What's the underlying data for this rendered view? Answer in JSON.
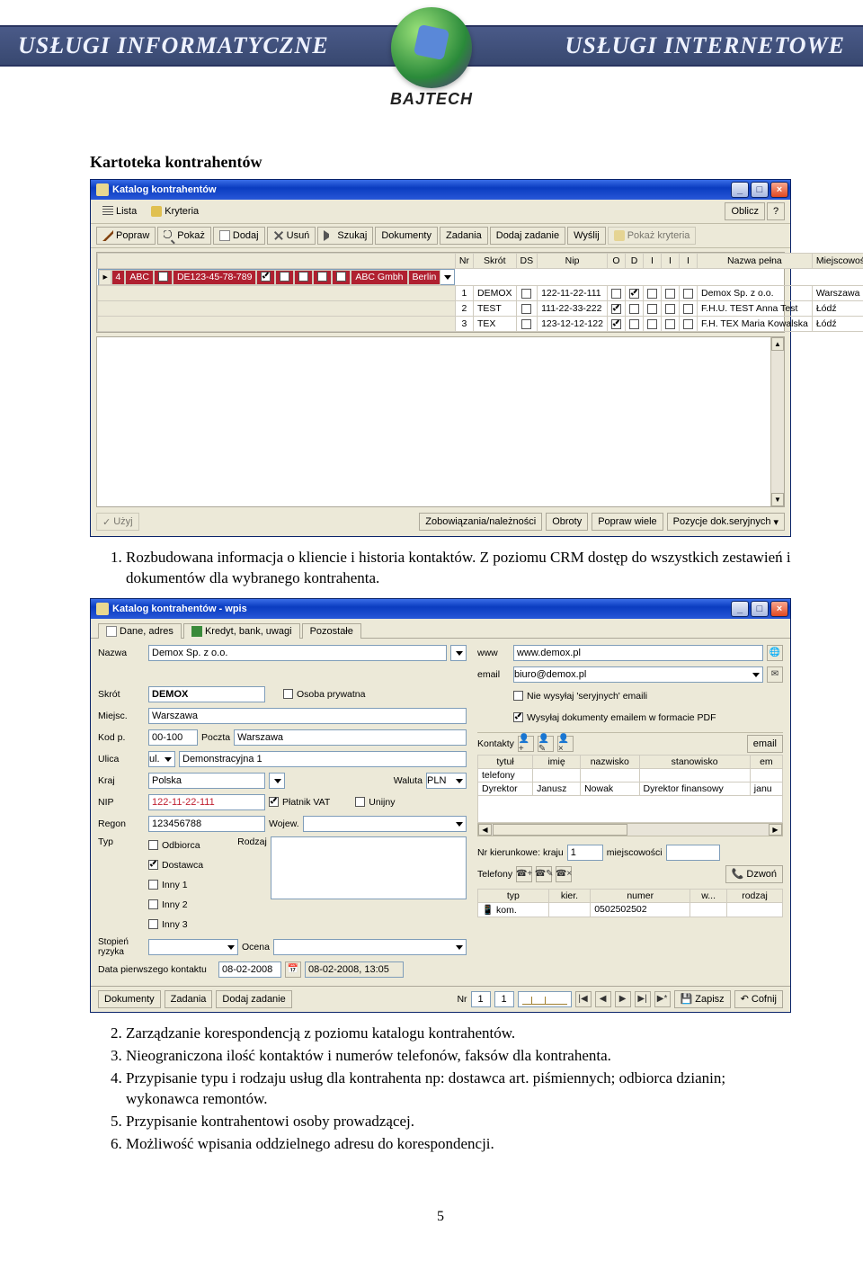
{
  "banner": {
    "left": "USŁUGI INFORMATYCZNE",
    "right": "USŁUGI INTERNETOWE",
    "logo_text": "BAJTECH"
  },
  "doc": {
    "heading": "Kartoteka kontrahentów",
    "list": [
      "Rozbudowana informacja o kliencie i historia kontaktów. Z poziomu CRM dostęp do wszystkich zestawień i dokumentów dla wybranego kontrahenta.",
      "Zarządzanie korespondencją z poziomu katalogu kontrahentów.",
      "Nieograniczona ilość kontaktów i numerów telefonów, faksów dla kontrahenta.",
      "Przypisanie typu i rodzaju usług dla kontrahenta np: dostawca art. piśmiennych; odbiorca dzianin; wykonawca remontów.",
      "Przypisanie kontrahentowi osoby prowadzącej.",
      "Możliwość wpisania oddzielnego adresu do korespondencji."
    ],
    "page_number": "5"
  },
  "win1": {
    "title": "Katalog kontrahentów",
    "tabs": {
      "list": "Lista",
      "criteria": "Kryteria"
    },
    "oblicz": "Oblicz",
    "toolbar": {
      "popraw": "Popraw",
      "pokaz": "Pokaż",
      "dodaj": "Dodaj",
      "usun": "Usuń",
      "szukaj": "Szukaj",
      "dokumenty": "Dokumenty",
      "zadania": "Zadania",
      "dodaj_zadanie": "Dodaj zadanie",
      "wyslij": "Wyślij",
      "pokaz_kryteria": "Pokaż kryteria"
    },
    "headers": {
      "nr": "Nr",
      "skrot": "Skrót",
      "ds": "DS",
      "nip": "Nip",
      "o": "O",
      "d": "D",
      "i1": "I",
      "i2": "I",
      "i3": "I",
      "nazwa": "Nazwa pełna",
      "miasto": "Miejscowość"
    },
    "rows": [
      {
        "nr": "4",
        "skrot": "ABC",
        "ds": false,
        "nip": "DE123-45-78-789",
        "o": true,
        "d": false,
        "i1": false,
        "i2": false,
        "i3": false,
        "nazwa": "ABC Gmbh",
        "miasto": "Berlin",
        "selected": true
      },
      {
        "nr": "1",
        "skrot": "DEMOX",
        "ds": false,
        "nip": "122-11-22-111",
        "o": false,
        "d": true,
        "i1": false,
        "i2": false,
        "i3": false,
        "nazwa": "Demox Sp. z o.o.",
        "miasto": "Warszawa"
      },
      {
        "nr": "2",
        "skrot": "TEST",
        "ds": false,
        "nip": "111-22-33-222",
        "o": true,
        "d": false,
        "i1": false,
        "i2": false,
        "i3": false,
        "nazwa": "F.H.U. TEST Anna Test",
        "miasto": "Łódź"
      },
      {
        "nr": "3",
        "skrot": "TEX",
        "ds": false,
        "nip": "123-12-12-122",
        "o": true,
        "d": false,
        "i1": false,
        "i2": false,
        "i3": false,
        "nazwa": "F.H. TEX Maria Kowalska",
        "miasto": "Łódź"
      }
    ],
    "bottom": {
      "uzyj": "Użyj",
      "zobow": "Zobowiązania/należności",
      "obroty": "Obroty",
      "popraw_wiele": "Popraw wiele",
      "pozycje": "Pozycje dok.seryjnych"
    }
  },
  "win2": {
    "title": "Katalog kontrahentów - wpis",
    "tabs": {
      "dane": "Dane, adres",
      "kredyt": "Kredyt, bank, uwagi",
      "pozostale": "Pozostałe"
    },
    "labels": {
      "nazwa": "Nazwa",
      "skrot": "Skrót",
      "osoba_pryw": "Osoba prywatna",
      "miejsc": "Miejsc.",
      "kodp": "Kod p.",
      "poczta": "Poczta",
      "ulica": "Ulica",
      "kraj": "Kraj",
      "waluta": "Waluta",
      "nip": "NIP",
      "platnik_vat": "Płatnik VAT",
      "unijny": "Unijny",
      "regon": "Regon",
      "wojew": "Wojew.",
      "typ": "Typ",
      "rodzaj": "Rodzaj",
      "odbiorca": "Odbiorca",
      "dostawca": "Dostawca",
      "inny1": "Inny 1",
      "inny2": "Inny 2",
      "inny3": "Inny 3",
      "stopien": "Stopień ryzyka",
      "ocena": "Ocena",
      "data_pierwszego": "Data pierwszego kontaktu",
      "www": "www",
      "email": "email",
      "nie_wysylaj": "Nie wysyłaj 'seryjnych' emaili",
      "wysylaj_pdf": "Wysyłaj dokumenty emailem w formacie PDF",
      "kontakty": "Kontakty",
      "email_btn": "email",
      "tytul": "tytuł",
      "imie": "imię",
      "nazwisko": "nazwisko",
      "stanowisko": "stanowisko",
      "em": "em",
      "telefony": "telefony",
      "dyrektor": "Dyrektor",
      "nr_kier": "Nr kierunkowe: kraju",
      "miejscowosci": "miejscowości",
      "telefony2": "Telefony",
      "dzwon": "Dzwoń",
      "typtel": "typ",
      "kier": "kier.",
      "numer": "numer",
      "w": "w...",
      "rodzajtel": "rodzaj",
      "kom": "kom."
    },
    "values": {
      "nazwa": "Demox Sp. z o.o.",
      "skrot": "DEMOX",
      "miejsc": "Warszawa",
      "kodp": "00-100",
      "poczta": "Warszawa",
      "ulica_pre": "ul.",
      "ulica": "Demonstracyjna 1",
      "kraj": "Polska",
      "waluta": "PLN",
      "nip": "122-11-22-111",
      "regon": "123456788",
      "data1": "08-02-2008",
      "data2": "08-02-2008, 13:05",
      "www": "www.demox.pl",
      "email": "biuro@demox.pl",
      "contact_imie": "Janusz",
      "contact_nazwisko": "Nowak",
      "contact_stan": "Dyrektor finansowy",
      "contact_em": "janu",
      "nr_kier_val": "1",
      "tel_num": "0502502502"
    },
    "footer": {
      "dokumenty": "Dokumenty",
      "zadania": "Zadania",
      "dodaj_zadanie": "Dodaj zadanie",
      "nr": "Nr",
      "zapisz": "Zapisz",
      "cofnij": "Cofnij",
      "nrval1": "1",
      "nrval2": "1"
    }
  }
}
